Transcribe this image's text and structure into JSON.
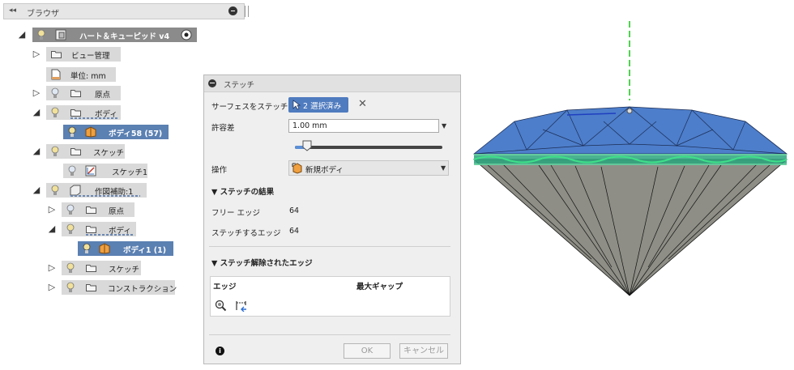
{
  "browser": {
    "title": "ブラウザ",
    "collapse_glyph": "◂◂",
    "tree": {
      "root": "ハート＆キューピッド v4",
      "view_mgmt": "ビュー管理",
      "units": "単位: mm",
      "origin": "原点",
      "bodies": "ボディ",
      "body58": "ボディ58 (57)",
      "sketches": "スケッチ",
      "sketch1": "スケッチ1",
      "construction_aid": "作図補助:1",
      "sub_origin": "原点",
      "sub_bodies": "ボディ",
      "body1": "ボディ1 (1)",
      "sub_sketches": "スケッチ",
      "construction": "コンストラクション"
    }
  },
  "dialog": {
    "title": "ステッチ",
    "stitch_surfaces_label": "サーフェスをステッチ",
    "selection_button": "2 選択済み",
    "tolerance_label": "許容差",
    "tolerance_value": "1.00 mm",
    "tolerance_slider_fraction": 0.06,
    "operation_label": "操作",
    "operation_value": "新規ボディ",
    "results_section": "ステッチの結果",
    "free_edges_label": "フリー エッジ",
    "free_edges_value": "64",
    "stitched_edges_label": "ステッチするエッジ",
    "stitched_edges_value": "64",
    "removed_section": "ステッチ解除されたエッジ",
    "col_edge": "エッジ",
    "col_max_gap": "最大ギャップ",
    "ok": "OK",
    "cancel": "キャンセル",
    "info_glyph": "i"
  },
  "colors": {
    "selection_blue": "#5b80b2",
    "button_blue": "#4f7bbf",
    "gem_top": "#4d7ecb",
    "gem_girdle": "#3fc98a",
    "gem_pavilion": "#8e8e86",
    "axis_green": "#19c219"
  }
}
